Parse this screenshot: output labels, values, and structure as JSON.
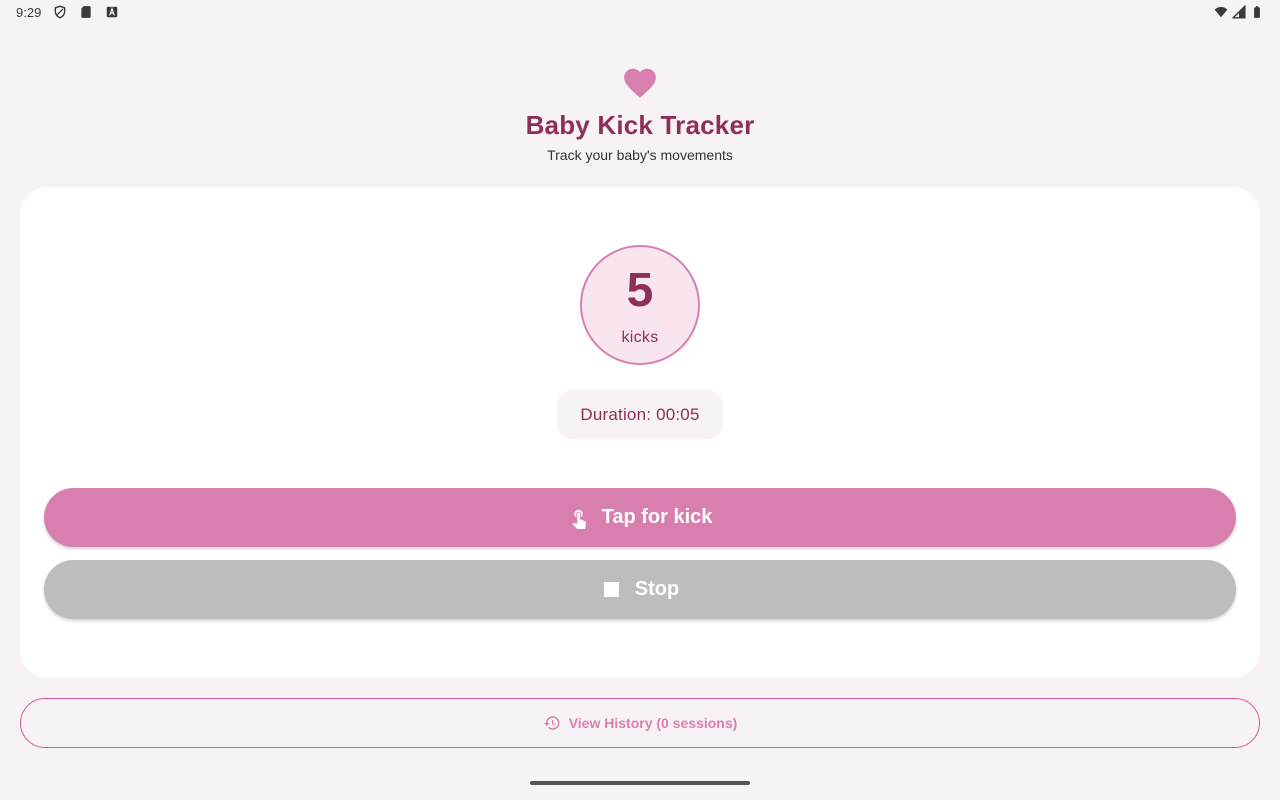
{
  "status_bar": {
    "time": "9:29",
    "left_icons": [
      "shield-icon",
      "sd-card-icon",
      "keyboard-a-icon"
    ],
    "right_icons": [
      "wifi-icon",
      "cellular-icon",
      "battery-icon"
    ]
  },
  "header": {
    "icon": "heart-icon",
    "title": "Baby Kick Tracker",
    "subtitle": "Track your baby's movements"
  },
  "counter": {
    "value": "5",
    "label": "kicks"
  },
  "duration": {
    "text": "Duration: 00:05"
  },
  "actions": {
    "kick_label": "Tap for kick",
    "kick_icon": "touch-icon",
    "stop_label": "Stop",
    "stop_icon": "stop-icon"
  },
  "history": {
    "label": "View History (0 sessions)",
    "icon": "history-icon"
  },
  "colors": {
    "accent": "#d87fb0",
    "primary_text": "#8e2f5a",
    "stop_button": "#bdbdbd",
    "background": "#f7f2f4",
    "card": "#ffffff"
  }
}
